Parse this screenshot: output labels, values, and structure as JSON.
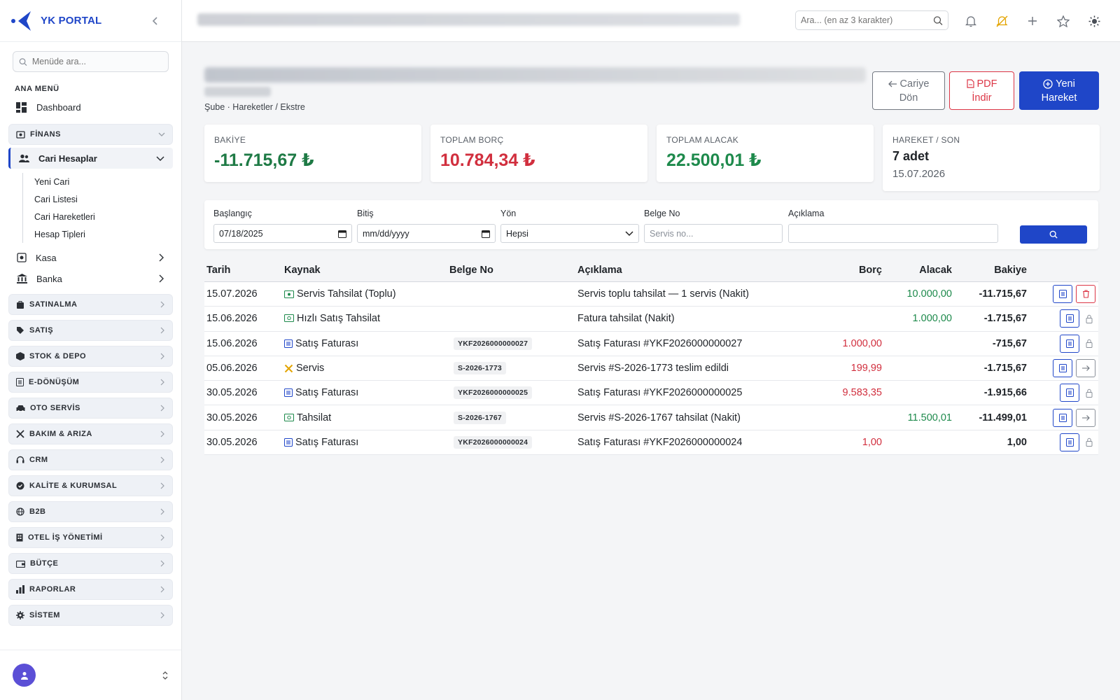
{
  "brand": {
    "name": "YK PORTAL"
  },
  "sidebar": {
    "search_placeholder": "Menüde ara...",
    "menu_title": "ANA MENÜ",
    "dashboard": "Dashboard",
    "finans": {
      "label": "FİNANS",
      "cari": {
        "label": "Cari Hesaplar",
        "items": [
          "Yeni Cari",
          "Cari Listesi",
          "Cari Hareketleri",
          "Hesap Tipleri"
        ]
      },
      "kasa": "Kasa",
      "banka": "Banka"
    },
    "sections": [
      "SATINALMA",
      "SATIŞ",
      "STOK & DEPO",
      "E-DÖNÜŞÜM",
      "OTO SERVİS",
      "BAKIM & ARIZA",
      "CRM",
      "KALİTE & KURUMSAL",
      "B2B",
      "OTEL İŞ YÖNETİMİ",
      "BÜTÇE",
      "RAPORLAR",
      "SİSTEM"
    ]
  },
  "topbar": {
    "search_placeholder": "Ara... (en az 3 karakter)"
  },
  "page": {
    "subtitle": "Şube · Hareketler / Ekstre",
    "btn_back": [
      "Cariye",
      "Dön"
    ],
    "btn_pdf": [
      "PDF",
      "İndir"
    ],
    "btn_new": [
      "Yeni",
      "Hareket"
    ]
  },
  "cards": {
    "bakiye": {
      "label": "BAKİYE",
      "value": "-11.715,67 ₺"
    },
    "borc": {
      "label": "TOPLAM BORÇ",
      "value": "10.784,34 ₺"
    },
    "alacak": {
      "label": "TOPLAM ALACAK",
      "value": "22.500,01 ₺"
    },
    "hareket": {
      "label": "HAREKET / SON",
      "count": "7 adet",
      "date": "15.07.2026"
    }
  },
  "filters": {
    "start": {
      "label": "Başlangıç",
      "value": "07/18/2025"
    },
    "end": {
      "label": "Bitiş",
      "value": "mm/dd/yyyy"
    },
    "direction": {
      "label": "Yön",
      "value": "Hepsi"
    },
    "doc": {
      "label": "Belge No",
      "placeholder": "Servis no..."
    },
    "desc": {
      "label": "Açıklama",
      "value": ""
    }
  },
  "table": {
    "headers": {
      "date": "Tarih",
      "src": "Kaynak",
      "doc": "Belge No",
      "desc": "Açıklama",
      "borc": "Borç",
      "alacak": "Alacak",
      "bakiye": "Bakiye"
    },
    "rows": [
      {
        "date": "15.07.2026",
        "src": "Servis Tahsilat (Toplu)",
        "doc": "",
        "desc": "Servis toplu tahsilat — 1 servis (Nakit)",
        "borc": "",
        "alacak": "10.000,00",
        "bakiye": "-11.715,67"
      },
      {
        "date": "15.06.2026",
        "src": "Hızlı Satış Tahsilat",
        "doc": "",
        "desc": "Fatura tahsilat (Nakit)",
        "borc": "",
        "alacak": "1.000,00",
        "bakiye": "-1.715,67"
      },
      {
        "date": "15.06.2026",
        "src": "Satış Faturası",
        "doc": "YKF2026000000027",
        "desc": "Satış Faturası #YKF2026000000027",
        "borc": "1.000,00",
        "alacak": "",
        "bakiye": "-715,67"
      },
      {
        "date": "05.06.2026",
        "src": "Servis",
        "doc": "S-2026-1773",
        "desc": "Servis #S-2026-1773 teslim edildi",
        "borc": "199,99",
        "alacak": "",
        "bakiye": "-1.715,67"
      },
      {
        "date": "30.05.2026",
        "src": "Satış Faturası",
        "doc": "YKF2026000000025",
        "desc": "Satış Faturası #YKF2026000000025",
        "borc": "9.583,35",
        "alacak": "",
        "bakiye": "-1.915,66"
      },
      {
        "date": "30.05.2026",
        "src": "Tahsilat",
        "doc": "S-2026-1767",
        "desc": "Servis #S-2026-1767 tahsilat (Nakit)",
        "borc": "",
        "alacak": "11.500,01",
        "bakiye": "-11.499,01"
      },
      {
        "date": "30.05.2026",
        "src": "Satış Faturası",
        "doc": "YKF2026000000024",
        "desc": "Satış Faturası #YKF2026000000024",
        "borc": "1,00",
        "alacak": "",
        "bakiye": "1,00"
      }
    ]
  },
  "colors": {
    "primary": "#1f46c8",
    "danger": "#dc3545",
    "success": "#1e8a4c"
  }
}
